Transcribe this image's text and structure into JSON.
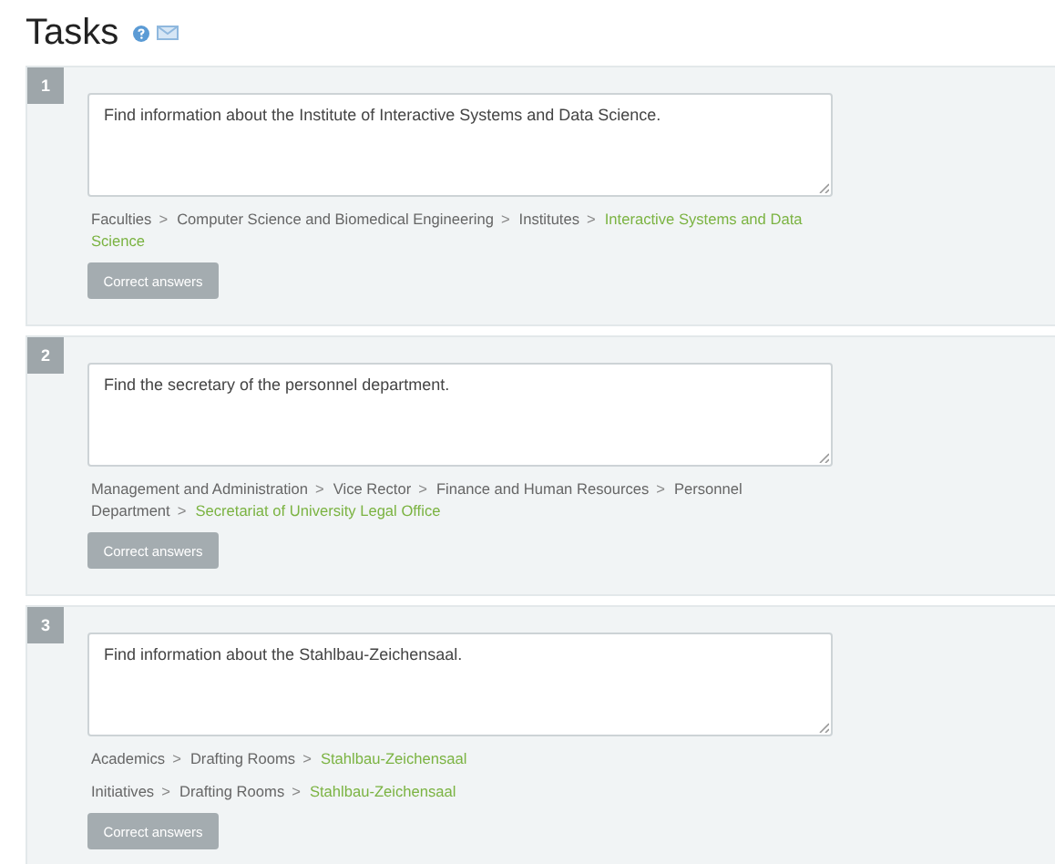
{
  "title": "Tasks",
  "tasks": [
    {
      "number": "1",
      "question": "Find information about the Institute of Interactive Systems and Data Science.",
      "paths": [
        [
          {
            "kind": "link",
            "text": "Faculties"
          },
          {
            "kind": "separator",
            "text": ">"
          },
          {
            "kind": "link",
            "text": "Computer Science and Biomedical Engineering"
          },
          {
            "kind": "separator",
            "text": ">"
          },
          {
            "kind": "link",
            "text": "Institutes"
          },
          {
            "kind": "separator",
            "text": ">"
          },
          {
            "kind": "current",
            "text": "Interactive Systems and Data"
          },
          {
            "kind": "current",
            "text": "Science"
          }
        ]
      ],
      "button": "Correct answers"
    },
    {
      "number": "2",
      "question": "Find the secretary of the personnel department.",
      "paths": [
        [
          {
            "kind": "link",
            "text": "Management and Administration"
          },
          {
            "kind": "separator",
            "text": ">"
          },
          {
            "kind": "link",
            "text": "Vice Rector"
          },
          {
            "kind": "separator",
            "text": ">"
          },
          {
            "kind": "link",
            "text": "Finance and Human Resources"
          },
          {
            "kind": "separator",
            "text": ">"
          },
          {
            "kind": "link",
            "text": "Personnel"
          },
          {
            "kind": "link",
            "text": "Department"
          },
          {
            "kind": "separator",
            "text": ">"
          },
          {
            "kind": "current",
            "text": "Secretariat of University Legal Office"
          }
        ]
      ],
      "button": "Correct answers"
    },
    {
      "number": "3",
      "question": "Find information about the Stahlbau-Zeichensaal.",
      "paths": [
        [
          {
            "kind": "link",
            "text": "Academics"
          },
          {
            "kind": "separator",
            "text": ">"
          },
          {
            "kind": "link",
            "text": "Drafting Rooms"
          },
          {
            "kind": "separator",
            "text": ">"
          },
          {
            "kind": "current",
            "text": "Stahlbau-Zeichensaal"
          }
        ],
        [
          {
            "kind": "link",
            "text": "Initiatives"
          },
          {
            "kind": "separator",
            "text": ">"
          },
          {
            "kind": "link",
            "text": "Drafting Rooms"
          },
          {
            "kind": "separator",
            "text": ">"
          },
          {
            "kind": "current",
            "text": "Stahlbau-Zeichensaal"
          }
        ]
      ],
      "button": "Correct answers"
    }
  ]
}
